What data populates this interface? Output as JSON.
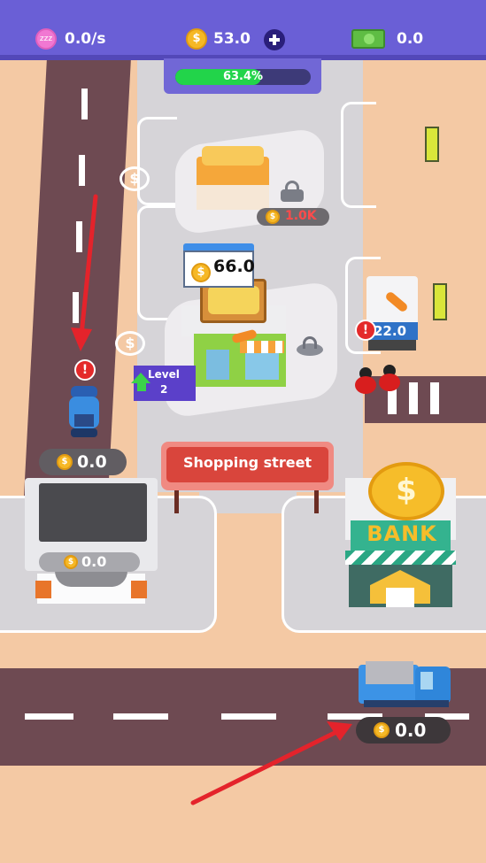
{
  "hud": {
    "income_rate": "0.0/s",
    "coins": "53.0",
    "cash": "0.0",
    "coin_symbol": "$"
  },
  "progress": {
    "label": "63.4%",
    "value": 0.634
  },
  "locked_shop": {
    "price": "1.0K"
  },
  "market": {
    "stock": "66.0",
    "level_label": "Level",
    "level_value": "2"
  },
  "veg_stand": {
    "value": "22.0",
    "alert": "!"
  },
  "scooter": {
    "value": "0.0",
    "alert": "!"
  },
  "truck_stop": {
    "value": "0.0"
  },
  "sign": {
    "text": "Shopping street"
  },
  "bank": {
    "label": "BANK"
  },
  "delivery_truck": {
    "value": "0.0"
  },
  "parking": {
    "symbol_1": "$",
    "symbol_2": "$"
  },
  "colors": {
    "topbar": "#6a5fd6",
    "progress_fill": "#22d44a",
    "ground": "#f4c9a4",
    "road": "#6e4a52",
    "sign_red": "#d9453c",
    "arrow_red": "#e4232b"
  }
}
